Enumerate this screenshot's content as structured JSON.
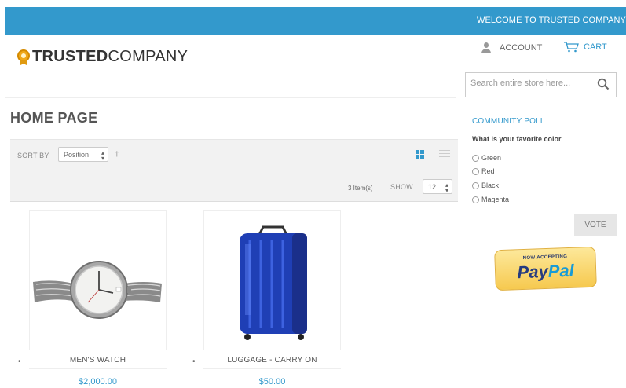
{
  "header": {
    "welcome": "WELCOME TO TRUSTED COMPANY",
    "logo_bold": "TRUSTED",
    "logo_light": "COMPANY",
    "account_label": "ACCOUNT",
    "cart_label": "CART"
  },
  "search": {
    "placeholder": "Search entire store here..."
  },
  "page": {
    "title": "HOME PAGE"
  },
  "toolbar": {
    "sort_label": "SORT BY",
    "sort_value": "Position",
    "sort_direction": "↑",
    "items_count": "3 Item(s)",
    "show_label": "SHOW",
    "show_value": "12"
  },
  "products": [
    {
      "name": "MEN'S WATCH",
      "price": "$2,000.00"
    },
    {
      "name": "LUGGAGE - CARRY ON",
      "price": "$50.00"
    }
  ],
  "poll": {
    "title": "COMMUNITY POLL",
    "question": "What is your favorite color",
    "options": [
      "Green",
      "Red",
      "Black",
      "Magenta"
    ],
    "vote_label": "VOTE"
  },
  "paypal": {
    "now_accepting": "NOW ACCEPTING",
    "brand_pay": "Pay",
    "brand_pal": "Pal"
  },
  "colors": {
    "accent": "#3399cc",
    "topbar": "#3399cc"
  }
}
